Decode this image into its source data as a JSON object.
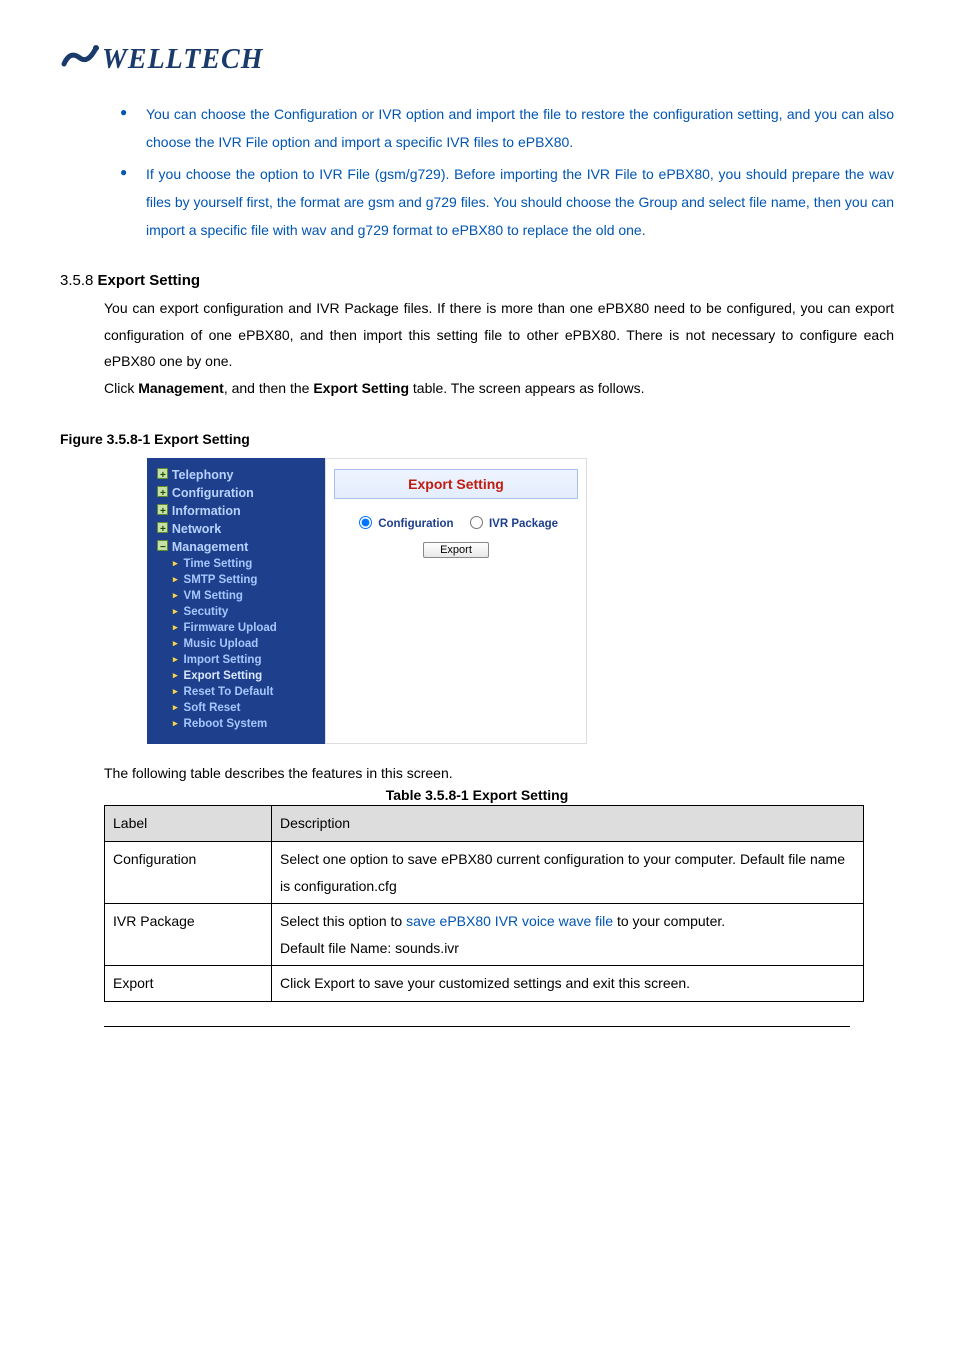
{
  "logo_text": "WELLTECH",
  "bullets": [
    "You can choose the Configuration or IVR option and import the file to restore the configuration setting, and you can also choose the IVR File option and import a specific IVR files to ePBX80.",
    "If you choose the option to IVR File (gsm/g729). Before importing the IVR File to ePBX80, you should prepare the wav files by yourself first, the format are gsm and g729 files. You should choose the Group and select file name, then you can import a specific file with wav and g729 format to ePBX80 to replace the old one."
  ],
  "section": {
    "number": "3.5.8",
    "title": "Export Setting",
    "body_line1": "You can export configuration and IVR Package files. If there is more than one ePBX80 need to be configured, you can export configuration of one ePBX80, and then import this setting file to other ePBX80. There is not necessary to configure each ePBX80 one by one.",
    "body_line2_pre": "Click ",
    "body_line2_b1": "Management",
    "body_line2_mid": ", and then the ",
    "body_line2_b2": "Export Setting",
    "body_line2_post": " table. The screen appears as follows."
  },
  "figure_caption": "Figure    3.5.8-1 Export Setting",
  "nav": {
    "top": [
      "Telephony",
      "Configuration",
      "Information",
      "Network",
      "Management"
    ],
    "sub": [
      "Time Setting",
      "SMTP Setting",
      "VM Setting",
      "Secutity",
      "Firmware Upload",
      "Music Upload",
      "Import Setting",
      "Export Setting",
      "Reset To Default",
      "Soft Reset",
      "Reboot System"
    ]
  },
  "panel": {
    "title": "Export Setting",
    "radio1": "Configuration",
    "radio2": "IVR Package",
    "button": "Export"
  },
  "post_fig": "The following table describes the features in this screen.",
  "table_caption": "Table 3.5.8-1 Export Setting",
  "table": {
    "headers": [
      "Label",
      "Description"
    ],
    "rows": [
      {
        "label": "Configuration",
        "desc": "Select one option to save ePBX80 current configuration to your computer. Default file name is configuration.cfg"
      },
      {
        "label": "IVR Package",
        "desc_pre": "Select this option to ",
        "desc_blue": "save ePBX80 IVR voice wave file",
        "desc_post": " to your computer.",
        "desc_line2": "Default file Name: sounds.ivr"
      },
      {
        "label": "Export",
        "desc": "Click Export to save your customized settings and exit this screen."
      }
    ]
  }
}
